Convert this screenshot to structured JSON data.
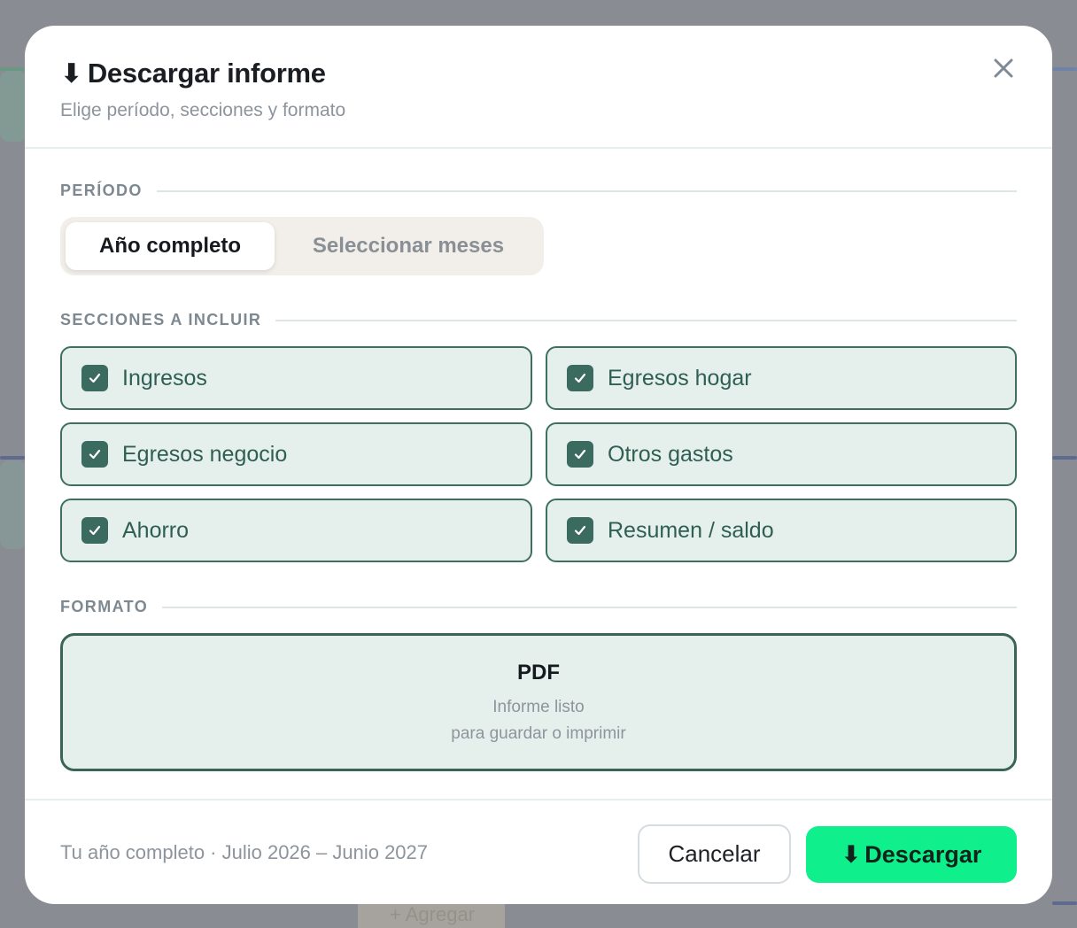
{
  "modal": {
    "title_icon": "⬇",
    "title": "Descargar informe",
    "subtitle": "Elige período, secciones y formato",
    "close_icon": "close-icon"
  },
  "period": {
    "label": "PERÍODO",
    "options": [
      "Año completo",
      "Seleccionar meses"
    ],
    "selected": "Año completo"
  },
  "sections": {
    "label": "SECCIONES A INCLUIR",
    "items": [
      {
        "label": "Ingresos",
        "checked": true
      },
      {
        "label": "Egresos hogar",
        "checked": true
      },
      {
        "label": "Egresos negocio",
        "checked": true
      },
      {
        "label": "Otros gastos",
        "checked": true
      },
      {
        "label": "Ahorro",
        "checked": true
      },
      {
        "label": "Resumen / saldo",
        "checked": true
      }
    ]
  },
  "format": {
    "label": "FORMATO",
    "option": {
      "title": "PDF",
      "desc_line1": "Informe listo",
      "desc_line2": "para guardar o imprimir",
      "selected": true
    }
  },
  "footer": {
    "note": "Tu año completo · Julio 2026 – Junio 2027",
    "cancel_label": "Cancelar",
    "download_icon": "⬇",
    "download_label": "Descargar"
  },
  "colors": {
    "accent": "#0ff08c",
    "card_bg": "#e5f0ed",
    "card_border": "#3d6f62",
    "checkbox": "#3a6b5e"
  }
}
